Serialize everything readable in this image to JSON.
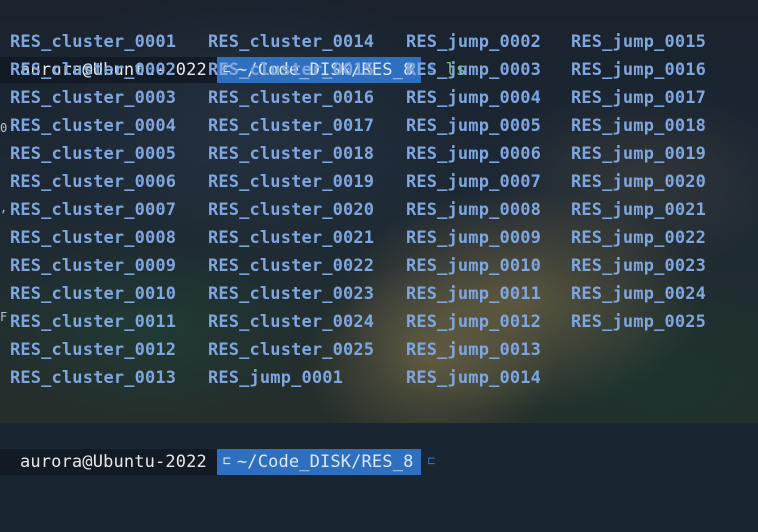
{
  "prompt": {
    "user_host": "aurora@Ubuntu-2022",
    "path": "~/Code_DISK/RES_8",
    "command": "ls"
  },
  "colors": {
    "user_segment_bg": "#121b25",
    "path_segment_bg": "#2f6fbf",
    "directory_listing": "#7fa6de",
    "command_text": "#7ec16b"
  },
  "listing": {
    "columns": [
      [
        "RES_cluster_0001",
        "RES_cluster_0002",
        "RES_cluster_0003",
        "RES_cluster_0004",
        "RES_cluster_0005",
        "RES_cluster_0006",
        "RES_cluster_0007",
        "RES_cluster_0008",
        "RES_cluster_0009",
        "RES_cluster_0010",
        "RES_cluster_0011",
        "RES_cluster_0012",
        "RES_cluster_0013"
      ],
      [
        "RES_cluster_0014",
        "RES_cluster_0015",
        "RES_cluster_0016",
        "RES_cluster_0017",
        "RES_cluster_0018",
        "RES_cluster_0019",
        "RES_cluster_0020",
        "RES_cluster_0021",
        "RES_cluster_0022",
        "RES_cluster_0023",
        "RES_cluster_0024",
        "RES_cluster_0025",
        "RES_jump_0001"
      ],
      [
        "RES_jump_0002",
        "RES_jump_0003",
        "RES_jump_0004",
        "RES_jump_0005",
        "RES_jump_0006",
        "RES_jump_0007",
        "RES_jump_0008",
        "RES_jump_0009",
        "RES_jump_0010",
        "RES_jump_0011",
        "RES_jump_0012",
        "RES_jump_0013",
        "RES_jump_0014"
      ],
      [
        "RES_jump_0015",
        "RES_jump_0016",
        "RES_jump_0017",
        "RES_jump_0018",
        "RES_jump_0019",
        "RES_jump_0020",
        "RES_jump_0021",
        "RES_jump_0022",
        "RES_jump_0023",
        "RES_jump_0024",
        "RES_jump_0025"
      ]
    ]
  },
  "second_prompt": {
    "user_host": "aurora@Ubuntu-2022",
    "path": "~/Code_DISK/RES_8"
  }
}
